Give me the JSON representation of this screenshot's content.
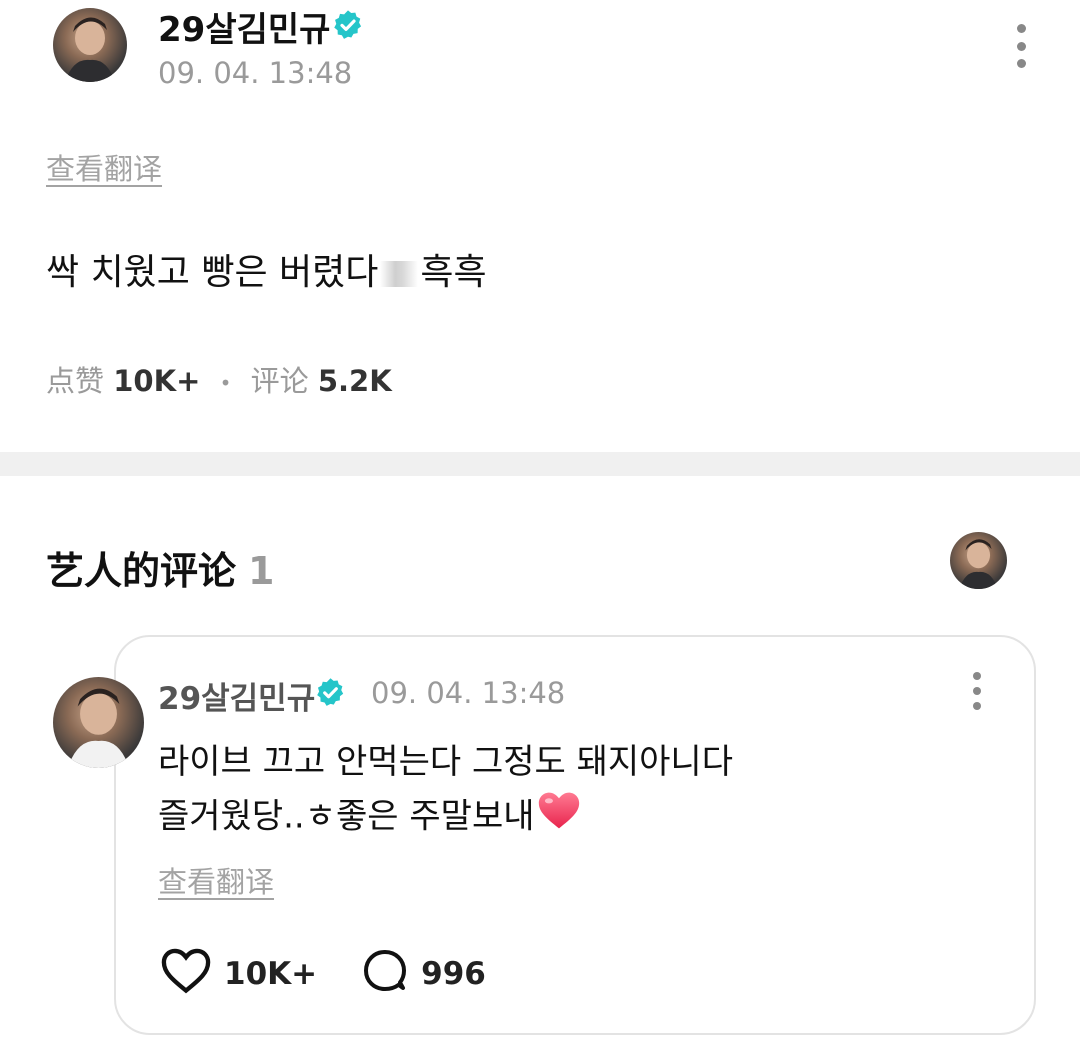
{
  "post": {
    "author": "29살김민규",
    "timestamp": "09. 04. 13:48",
    "translate_label": "查看翻译",
    "text_before": "싹 치웠고 빵은 버렸다",
    "text_after": "흑흑",
    "stats": {
      "likes_label": "点赞",
      "likes_value": "10K+",
      "comments_label": "评论",
      "comments_value": "5.2K"
    }
  },
  "artist_comments": {
    "title": "艺人的评论",
    "count": "1",
    "comment": {
      "author": "29살김민규",
      "timestamp": "09. 04. 13:48",
      "line1": "라이브 끄고 안먹는다 그정도 돼지아니다",
      "line2": "즐거웠당..ㅎ좋은 주말보내",
      "translate_label": "查看翻译",
      "likes": "10K+",
      "replies": "996"
    }
  },
  "colors": {
    "verified": "#25c5c9",
    "muted": "#9a9a9a",
    "heart_emoji": "#ff4d6d"
  },
  "icons": [
    "verified-badge-icon",
    "more-options-icon",
    "heart-icon",
    "comment-bubble-icon",
    "red-heart-emoji-icon"
  ]
}
